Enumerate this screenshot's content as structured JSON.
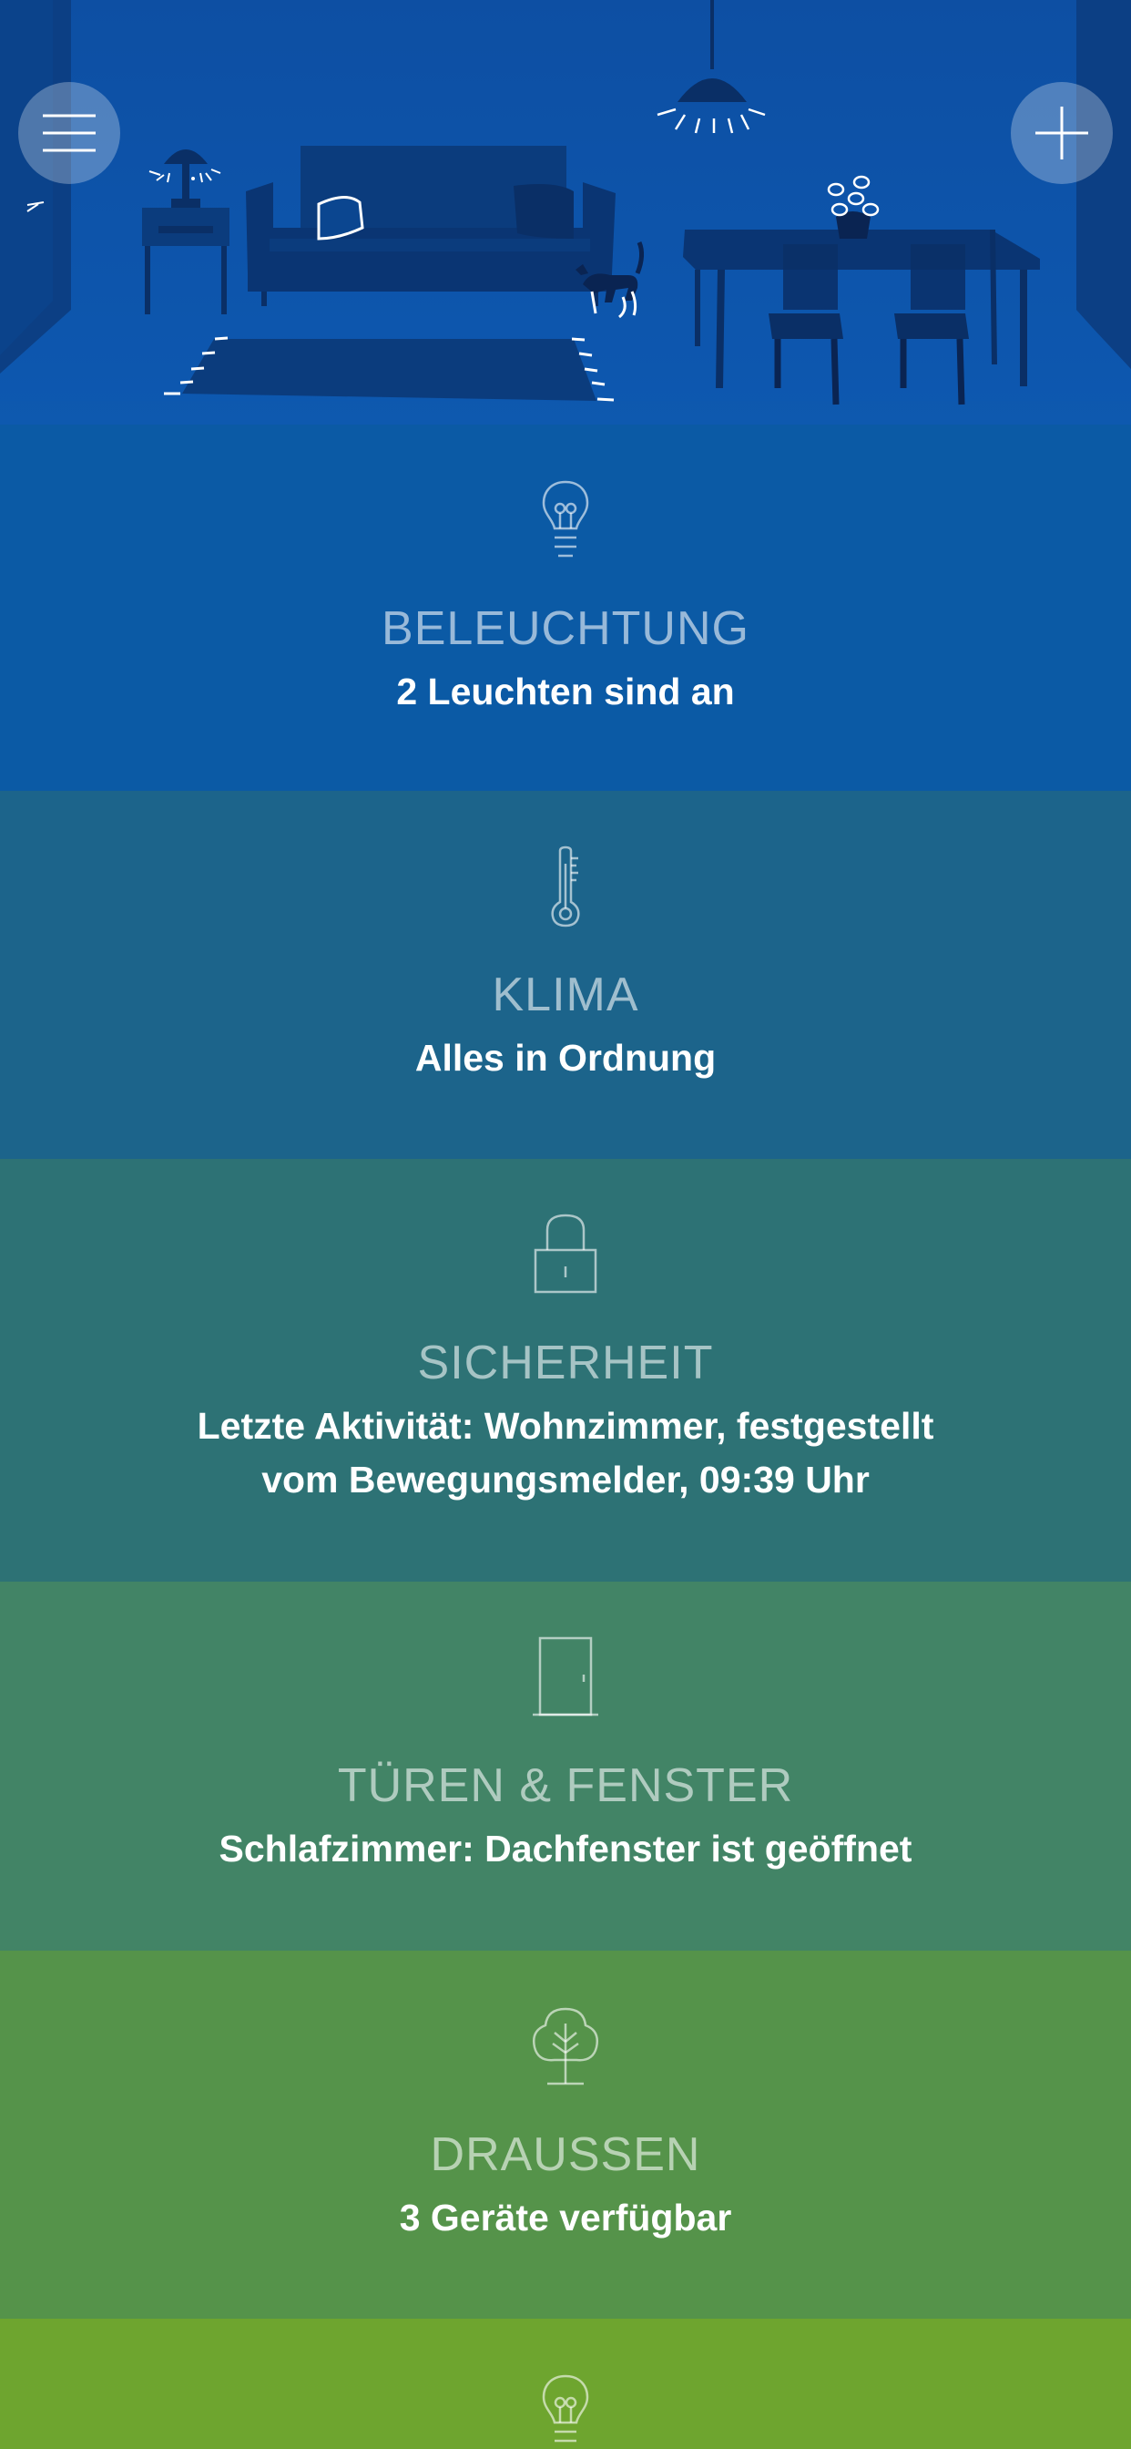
{
  "header": {
    "menu_icon": "hamburger-menu-icon",
    "add_icon": "plus-icon",
    "illustration": "living-room-illustration"
  },
  "sections": [
    {
      "icon": "lightbulb-icon",
      "title": "BELEUCHTUNG",
      "status": "2 Leuchten sind an",
      "color": "#0b5aa5"
    },
    {
      "icon": "thermometer-icon",
      "title": "KLIMA",
      "status": "Alles in Ordnung",
      "color": "#1c648b"
    },
    {
      "icon": "padlock-icon",
      "title": "SICHERHEIT",
      "status": "Letzte Aktivität: Wohnzimmer, festgestellt vom Bewegungsmelder, 09:39 Uhr",
      "color": "#2d7275"
    },
    {
      "icon": "door-icon",
      "title": "TÜREN & FENSTER",
      "status": "Schlafzimmer: Dachfenster ist geöffnet",
      "color": "#428466"
    },
    {
      "icon": "tree-icon",
      "title": "DRAUSSEN",
      "status": "3 Geräte verfügbar",
      "color": "#55934a"
    },
    {
      "icon": "lightbulb-icon",
      "title": "",
      "status": "",
      "color": "#6ea52f"
    }
  ]
}
